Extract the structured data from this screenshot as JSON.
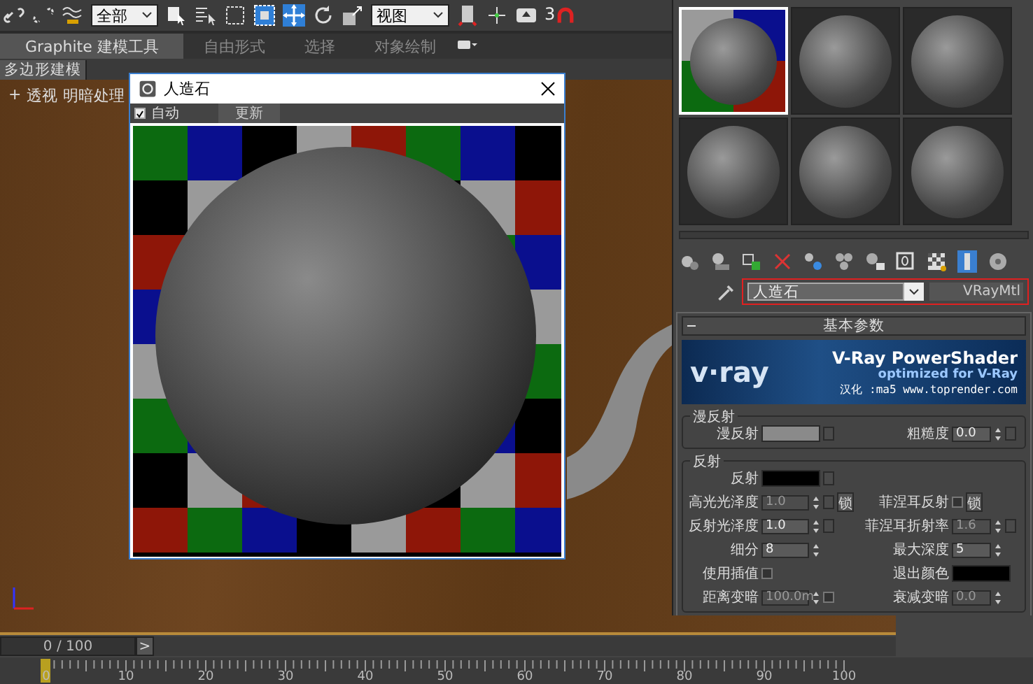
{
  "toolbar": {
    "selection_filter": "全部",
    "reference_coord": "视图",
    "snap_label": "3"
  },
  "ribbon": {
    "tabs": [
      {
        "label": "Graphite 建模工具",
        "selected": true
      },
      {
        "label": "自由形式",
        "selected": false
      },
      {
        "label": "选择",
        "selected": false
      },
      {
        "label": "对象绘制",
        "selected": false
      }
    ],
    "panel_label": "多边形建模"
  },
  "viewport": {
    "labels": [
      "+",
      "透视",
      "明暗处理"
    ]
  },
  "preview_window": {
    "title": "人造石",
    "auto": {
      "label": "自动",
      "checked": true
    },
    "update_button": "更新"
  },
  "material_editor": {
    "sample_slots": [
      {
        "selected": true
      },
      {
        "selected": false
      },
      {
        "selected": false
      },
      {
        "selected": false
      },
      {
        "selected": false
      },
      {
        "selected": false
      }
    ],
    "material_name": "人造石",
    "material_type": "VRayMtl",
    "rollout_title": "基本参数",
    "banner": {
      "logo": "v·ray",
      "title": "V-Ray PowerShader",
      "subtitle": "optimized for V-Ray",
      "credit": "汉化 :ma5 www.toprender.com"
    },
    "diffuse": {
      "title": "漫反射",
      "rows": [
        {
          "left": {
            "kind": "color",
            "label": "漫反射",
            "color": "#8a8a8a",
            "map_button": true
          },
          "right": {
            "kind": "number",
            "label": "粗糙度",
            "value": "0.0",
            "disabled": false,
            "map_button": true
          }
        }
      ]
    },
    "reflection": {
      "title": "反射",
      "rows": [
        {
          "left": {
            "kind": "color",
            "label": "反射",
            "color": "#000000",
            "map_button": true
          }
        },
        {
          "left": {
            "kind": "number",
            "label": "高光光泽度",
            "value": "1.0",
            "disabled": true,
            "map_button": true,
            "button": "锁"
          },
          "right": {
            "kind": "check",
            "label": "菲涅耳反射",
            "checked": false,
            "button": "锁"
          }
        },
        {
          "left": {
            "kind": "number",
            "label": "反射光泽度",
            "value": "1.0",
            "disabled": false,
            "map_button": true
          },
          "right": {
            "kind": "number",
            "label": "菲涅耳折射率",
            "value": "1.6",
            "disabled": true,
            "map_button": true
          }
        },
        {
          "left": {
            "kind": "number",
            "label": "细分",
            "value": "8",
            "disabled": false
          },
          "right": {
            "kind": "number",
            "label": "最大深度",
            "value": "5",
            "disabled": false
          }
        },
        {
          "left": {
            "kind": "check",
            "label": "使用插值",
            "checked": false
          },
          "right": {
            "kind": "color",
            "label": "退出颜色",
            "color": "#000000"
          }
        },
        {
          "left": {
            "kind": "number",
            "label": "距离变暗",
            "value": "100.0m",
            "disabled": true,
            "checked": false
          },
          "right": {
            "kind": "number",
            "label": "衰减变暗",
            "value": "0.0",
            "disabled": true
          }
        }
      ]
    }
  },
  "timeline": {
    "frame_counter": "0 / 100",
    "next_button": ">",
    "ruler_labels": [
      "0",
      "10",
      "20",
      "30",
      "40",
      "50",
      "60",
      "70",
      "80",
      "90",
      "100"
    ]
  }
}
